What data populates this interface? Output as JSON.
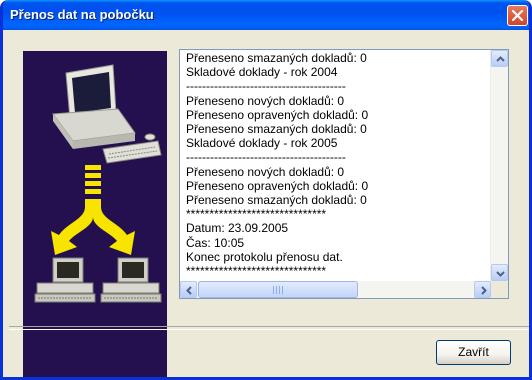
{
  "window": {
    "title": "Přenos dat na pobočku"
  },
  "log": {
    "text": "Přeneseno smazaných dokladů: 0\nSkladové doklady - rok 2004\n----------------------------------------\nPřeneseno nových dokladů: 0\nPřeneseno opravených dokladů: 0\nPřeneseno smazaných dokladů: 0\nSkladové doklady - rok 2005\n----------------------------------------\nPřeneseno nových dokladů: 0\nPřeneseno opravených dokladů: 0\nPřeneseno smazaných dokladů: 0\n******************************\nDatum: 23.09.2005\nČas: 10:05\nKonec protokolu přenosu dat.\n******************************"
  },
  "buttons": {
    "close_label": "Zavřít"
  },
  "horizontal_scroll_grip": "III",
  "icons": {
    "title_close": "close-x-icon",
    "scroll_up": "arrow-up-icon",
    "scroll_down": "arrow-down-icon",
    "scroll_left": "arrow-left-icon",
    "scroll_right": "arrow-right-icon",
    "artwork": "data-transfer-illustration"
  },
  "colors": {
    "titlebar": "#0055e5",
    "dialog_bg": "#ece9d8",
    "art_bg": "#24104f",
    "arrow": "#f7e500"
  }
}
